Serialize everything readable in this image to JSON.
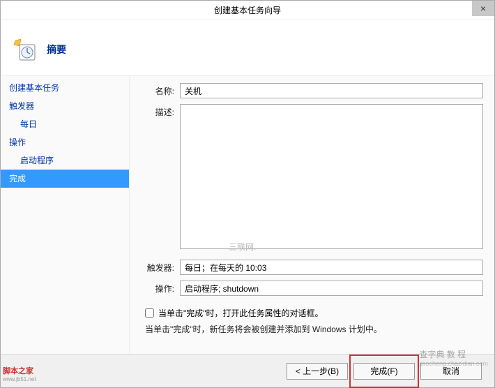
{
  "window": {
    "title": "创建基本任务向导",
    "close_glyph": "×"
  },
  "header": {
    "title": "摘要"
  },
  "sidebar": {
    "items": [
      {
        "label": "创建基本任务",
        "sub": false,
        "active": false
      },
      {
        "label": "触发器",
        "sub": false,
        "active": false
      },
      {
        "label": "每日",
        "sub": true,
        "active": false
      },
      {
        "label": "操作",
        "sub": false,
        "active": false
      },
      {
        "label": "启动程序",
        "sub": true,
        "active": false
      },
      {
        "label": "完成",
        "sub": false,
        "active": true
      }
    ]
  },
  "form": {
    "name_label": "名称:",
    "name_value": "关机",
    "desc_label": "描述:",
    "desc_value": "",
    "trigger_label": "触发器:",
    "trigger_value": "每日；在每天的 10:03",
    "action_label": "操作:",
    "action_value": "启动程序; shutdown",
    "checkbox_label": "当单击\"完成\"时，打开此任务属性的对话框。",
    "hint_text": "当单击\"完成\"时，新任务将会被创建并添加到 Windows 计划中。"
  },
  "buttons": {
    "back": "< 上一步(B)",
    "finish": "完成(F)",
    "cancel": "取消"
  },
  "watermarks": {
    "center": "三联网.",
    "logo_main": "脚本之家",
    "logo_sub": "www.jb51.net",
    "right_main": "查字典 教 程",
    "right_sub": "jiaocheng.chazidian.com"
  }
}
